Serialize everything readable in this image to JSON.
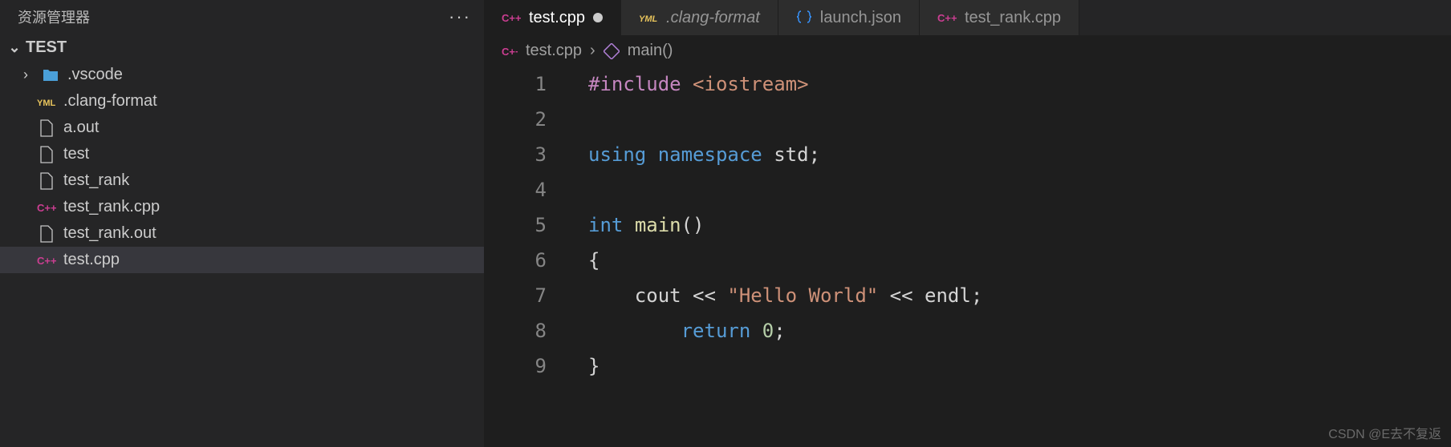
{
  "explorer": {
    "title": "资源管理器",
    "folder_name": "TEST",
    "items": [
      {
        "name": ".vscode",
        "type": "folder"
      },
      {
        "name": ".clang-format",
        "type": "yaml"
      },
      {
        "name": "a.out",
        "type": "file"
      },
      {
        "name": "test",
        "type": "file"
      },
      {
        "name": "test_rank",
        "type": "file"
      },
      {
        "name": "test_rank.cpp",
        "type": "cpp"
      },
      {
        "name": "test_rank.out",
        "type": "file"
      },
      {
        "name": "test.cpp",
        "type": "cpp",
        "selected": true
      }
    ]
  },
  "tabs": [
    {
      "label": "test.cpp",
      "type": "cpp",
      "active": true,
      "dirty": true
    },
    {
      "label": ".clang-format",
      "type": "yaml",
      "italic": true
    },
    {
      "label": "launch.json",
      "type": "json"
    },
    {
      "label": "test_rank.cpp",
      "type": "cpp"
    }
  ],
  "breadcrumb": {
    "file": "test.cpp",
    "symbol": "main()"
  },
  "code": {
    "lines": [
      [
        {
          "t": "directive",
          "v": "#include"
        },
        {
          "t": "punc",
          "v": " "
        },
        {
          "t": "string",
          "v": "<iostream>"
        }
      ],
      [],
      [
        {
          "t": "keyword",
          "v": "using"
        },
        {
          "t": "punc",
          "v": " "
        },
        {
          "t": "keyword",
          "v": "namespace"
        },
        {
          "t": "punc",
          "v": " "
        },
        {
          "t": "ident",
          "v": "std"
        },
        {
          "t": "punc",
          "v": ";"
        }
      ],
      [],
      [
        {
          "t": "type",
          "v": "int"
        },
        {
          "t": "punc",
          "v": " "
        },
        {
          "t": "func",
          "v": "main"
        },
        {
          "t": "punc",
          "v": "()"
        }
      ],
      [
        {
          "t": "punc",
          "v": "{"
        }
      ],
      [
        {
          "t": "punc",
          "v": "    "
        },
        {
          "t": "ident",
          "v": "cout"
        },
        {
          "t": "punc",
          "v": " << "
        },
        {
          "t": "string",
          "v": "\"Hello World\""
        },
        {
          "t": "punc",
          "v": " << "
        },
        {
          "t": "ident",
          "v": "endl"
        },
        {
          "t": "punc",
          "v": ";"
        }
      ],
      [
        {
          "t": "punc",
          "v": "        "
        },
        {
          "t": "keyword",
          "v": "return"
        },
        {
          "t": "punc",
          "v": " "
        },
        {
          "t": "num",
          "v": "0"
        },
        {
          "t": "punc",
          "v": ";"
        }
      ],
      [
        {
          "t": "punc",
          "v": "}"
        }
      ]
    ]
  },
  "watermark": "CSDN @E去不复返"
}
